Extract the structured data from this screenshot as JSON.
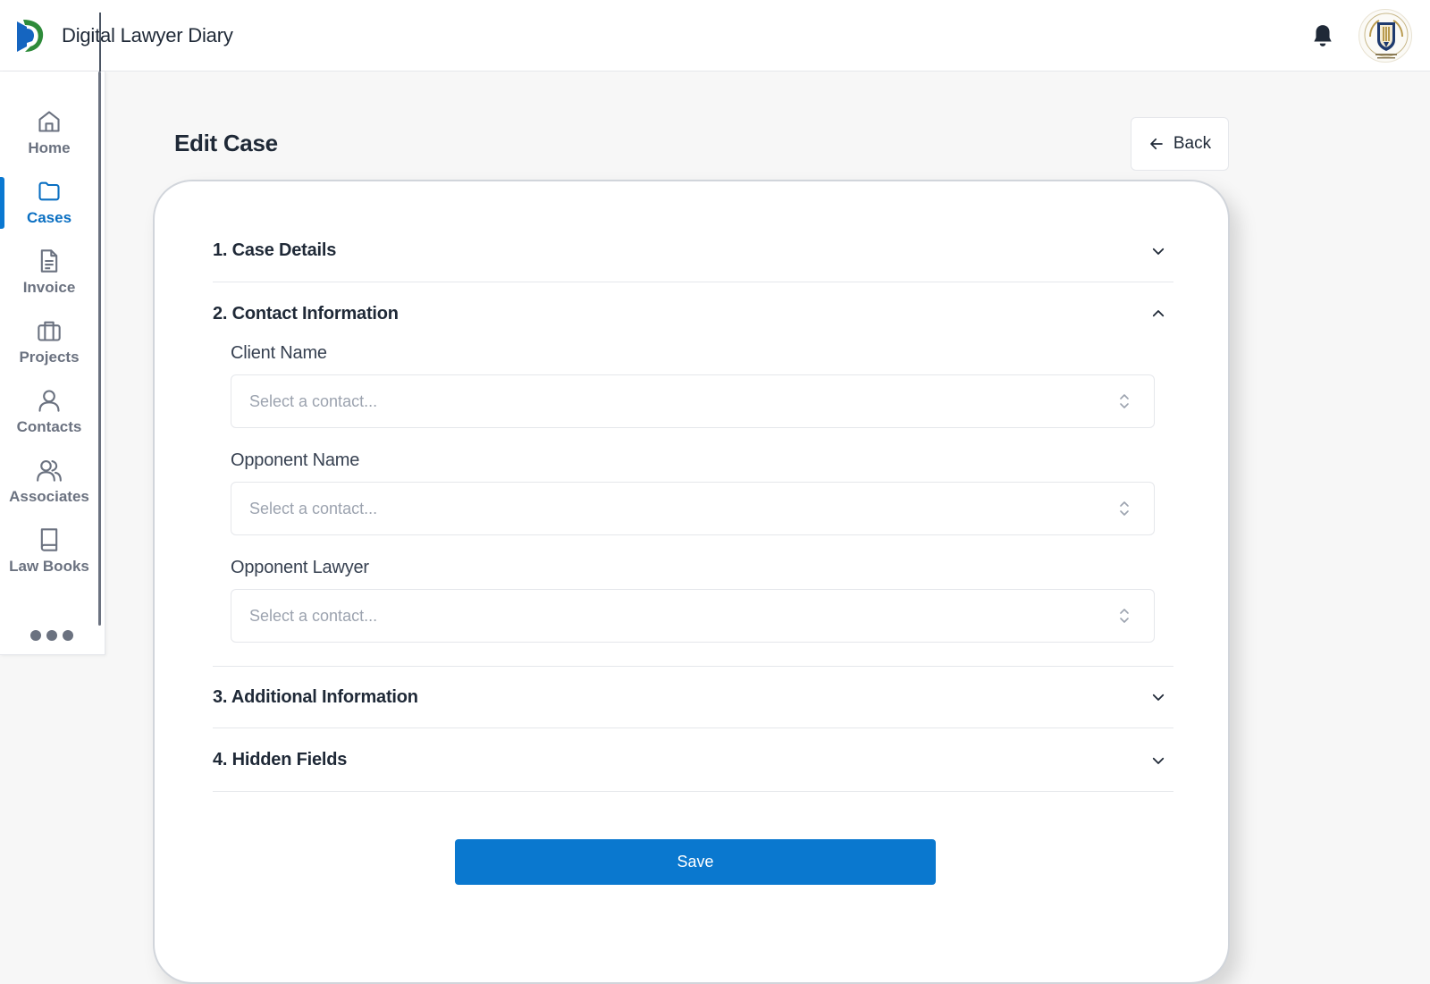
{
  "app": {
    "title": "Digital Lawyer Diary"
  },
  "colors": {
    "accent": "#0a78cf",
    "logo_blue": "#1565c0",
    "logo_green": "#2e8b3a"
  },
  "header": {
    "notification_icon": "bell-icon",
    "avatar_icon": "law-company-seal-icon"
  },
  "sidebar": {
    "items": [
      {
        "label": "Home",
        "icon": "home-icon"
      },
      {
        "label": "Cases",
        "icon": "folder-icon",
        "active": true
      },
      {
        "label": "Invoice",
        "icon": "document-icon"
      },
      {
        "label": "Projects",
        "icon": "briefcase-icon"
      },
      {
        "label": "Contacts",
        "icon": "user-icon"
      },
      {
        "label": "Associates",
        "icon": "users-icon"
      },
      {
        "label": "Law Books",
        "icon": "book-icon"
      }
    ],
    "more_icon": "more-dots-icon"
  },
  "page": {
    "title": "Edit Case",
    "back_label": "Back"
  },
  "sections": [
    {
      "title": "1. Case Details",
      "expanded": false
    },
    {
      "title": "2. Contact Information",
      "expanded": true
    },
    {
      "title": "3. Additional Information",
      "expanded": false
    },
    {
      "title": "4. Hidden Fields",
      "expanded": false
    }
  ],
  "contact_fields": [
    {
      "label": "Client Name",
      "placeholder": "Select a contact..."
    },
    {
      "label": "Opponent Name",
      "placeholder": "Select a contact..."
    },
    {
      "label": "Opponent Lawyer",
      "placeholder": "Select a contact..."
    }
  ],
  "save_label": "Save"
}
